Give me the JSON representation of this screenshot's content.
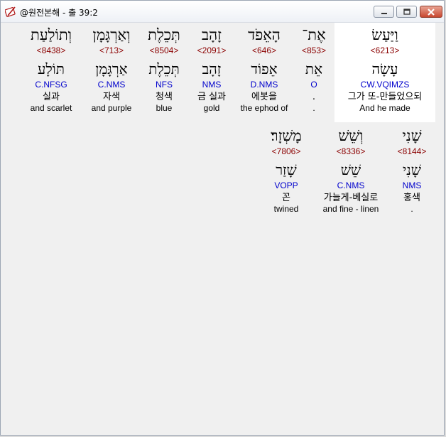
{
  "window": {
    "title": "@원전본해 - 출 39:2",
    "controls": {
      "minimize": "minimize-icon",
      "maximize": "maximize-icon",
      "close": "close-icon"
    }
  },
  "colors": {
    "strong": "#8b0000",
    "morph": "#0000cc",
    "highlight": "#ffffff",
    "background": "#f0f0f0"
  },
  "words": [
    {
      "hebrew": "וַיַּעַשׂ",
      "strong": "<6213>",
      "lemma": "עָשָׂה",
      "morph": "CW.VQIMZS",
      "korean": "그가 또-만들었으되",
      "english": "And he made",
      "selected": true
    },
    {
      "hebrew": "אֶת־",
      "strong": "<853>",
      "lemma": "אֵת",
      "morph": "O",
      "korean": ".",
      "english": "."
    },
    {
      "hebrew": "הָאֵפֹד",
      "strong": "<646>",
      "lemma": "אֵפוֹד",
      "morph": "D.NMS",
      "korean": "에봇을",
      "english": "the ephod of"
    },
    {
      "hebrew": "זָהָב",
      "strong": "<2091>",
      "lemma": "זָהָב",
      "morph": "NMS",
      "korean": "금 실과",
      "english": "gold"
    },
    {
      "hebrew": "תְּכֵלֶת",
      "strong": "<8504>",
      "lemma": "תְּכֵלֶת",
      "morph": "NFS",
      "korean": "청색",
      "english": "blue"
    },
    {
      "hebrew": "וְאַרְגָּמָן",
      "strong": "<713>",
      "lemma": "אַרְגָּמָן",
      "morph": "C.NMS",
      "korean": "자색",
      "english": "and purple"
    },
    {
      "hebrew": "וְתוֹלַעַת",
      "strong": "<8438>",
      "lemma": "תּוֹלָע",
      "morph": "C.NFSG",
      "korean": "실과",
      "english": "and scarlet"
    },
    {
      "hebrew": "שָׁנִי",
      "strong": "<8144>",
      "lemma": "שָׁנִי",
      "morph": "NMS",
      "korean": "홍색",
      "english": "."
    },
    {
      "hebrew": "וְשֵׁשׁ",
      "strong": "<8336>",
      "lemma": "שֵׁשׁ",
      "morph": "C.NMS",
      "korean": "가늘게-베실로",
      "english": "and fine - linen"
    },
    {
      "hebrew": "מָשְׁזָר׃",
      "strong": "<7806>",
      "lemma": "שָׁזַר",
      "morph": "VOPP",
      "korean": "꼰",
      "english": "twined"
    }
  ]
}
